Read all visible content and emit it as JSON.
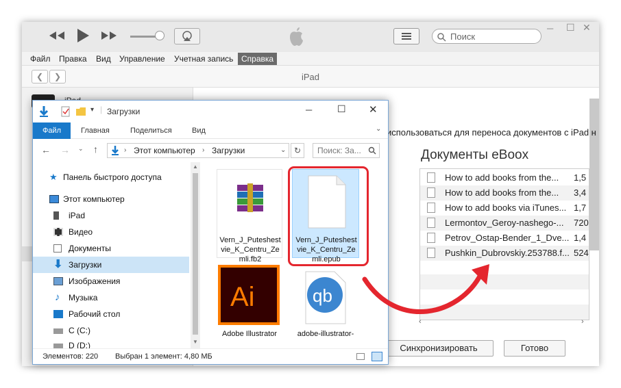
{
  "itunes": {
    "search_placeholder": "Поиск",
    "menu": [
      "Файл",
      "Правка",
      "Вид",
      "Управление",
      "Учетная запись",
      "Справка"
    ],
    "device_title": "iPad",
    "left_device": "iPad",
    "info_text": "использоваться для переноса документов с iPad н",
    "docs_title": "Документы eBoox",
    "docs": [
      {
        "name": "How to add books from the...",
        "size": "1,5"
      },
      {
        "name": "How to add books from the...",
        "size": "3,4"
      },
      {
        "name": "How to add books via iTunes...",
        "size": "1,7"
      },
      {
        "name": "Lermontov_Geroy-nashego-...",
        "size": "720"
      },
      {
        "name": "Petrov_Ostap-Bender_1_Dve...",
        "size": "1,4"
      },
      {
        "name": "Pushkin_Dubrovskiy.253788.f...",
        "size": "524"
      }
    ],
    "sync_label": "Синхронизировать",
    "done_label": "Готово"
  },
  "explorer": {
    "title": "Загрузки",
    "tabs": [
      "Файл",
      "Главная",
      "Поделиться",
      "Вид"
    ],
    "path_root": "Этот компьютер",
    "path_folder": "Загрузки",
    "search_placeholder": "Поиск: За...",
    "nav": [
      {
        "label": "Панель быстрого доступа",
        "icon": "star-icon"
      },
      {
        "label": "Этот компьютер",
        "icon": "computer-icon"
      },
      {
        "label": "iPad",
        "icon": "tablet-icon"
      },
      {
        "label": "Видео",
        "icon": "video-icon"
      },
      {
        "label": "Документы",
        "icon": "document-icon"
      },
      {
        "label": "Загрузки",
        "icon": "download-icon"
      },
      {
        "label": "Изображения",
        "icon": "image-icon"
      },
      {
        "label": "Музыка",
        "icon": "music-icon"
      },
      {
        "label": "Рабочий стол",
        "icon": "desktop-icon"
      },
      {
        "label": "C (C:)",
        "icon": "drive-icon"
      },
      {
        "label": "D (D:)",
        "icon": "drive-icon"
      }
    ],
    "files": [
      {
        "name": "Vern_J_Puteshest vie_K_Centru_Ze mli.fb2",
        "icon": "winrar-icon"
      },
      {
        "name": "Vern_J_Puteshest vie_K_Centru_Ze mli.epub",
        "icon": "blank-file-icon"
      },
      {
        "name": "Adobe Illustrator",
        "icon": "adobe-illustrator-icon"
      },
      {
        "name": "adobe-illustrator-",
        "icon": "qbittorrent-icon"
      }
    ],
    "status_count": "Элементов: 220",
    "status_selected": "Выбран 1 элемент: 4,80 МБ"
  },
  "colors": {
    "accent": "#1979ca",
    "highlight": "#e4262e",
    "selection": "#cce4f7"
  }
}
